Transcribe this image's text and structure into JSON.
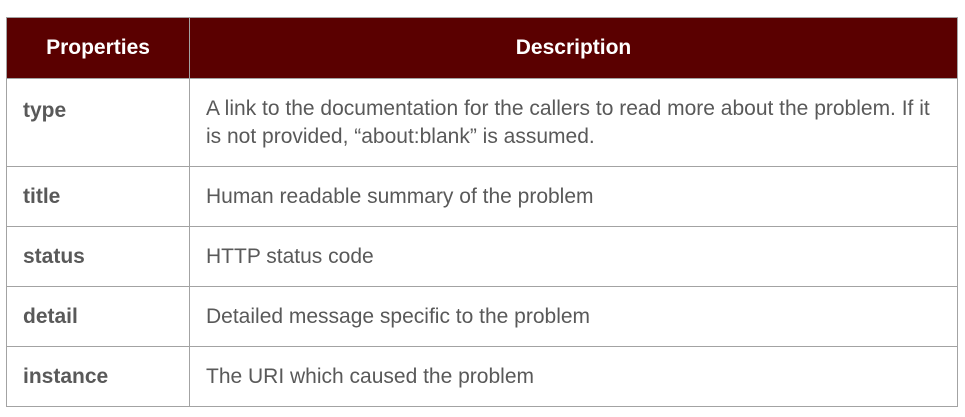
{
  "table": {
    "headers": {
      "properties": "Properties",
      "description": "Description"
    },
    "rows": [
      {
        "property": "type",
        "description": "A link to the documentation for the callers to read more about the problem. If it is not provided, “about:blank” is assumed."
      },
      {
        "property": "title",
        "description": "Human readable summary of the problem"
      },
      {
        "property": "status",
        "description": "HTTP status code"
      },
      {
        "property": "detail",
        "description": "Detailed message specific to the problem"
      },
      {
        "property": "instance",
        "description": "The URI which caused the problem"
      }
    ]
  },
  "colors": {
    "header_background": "#5a0000",
    "header_text": "#ffffff",
    "body_text": "#595959",
    "border": "#a3a3a3"
  }
}
